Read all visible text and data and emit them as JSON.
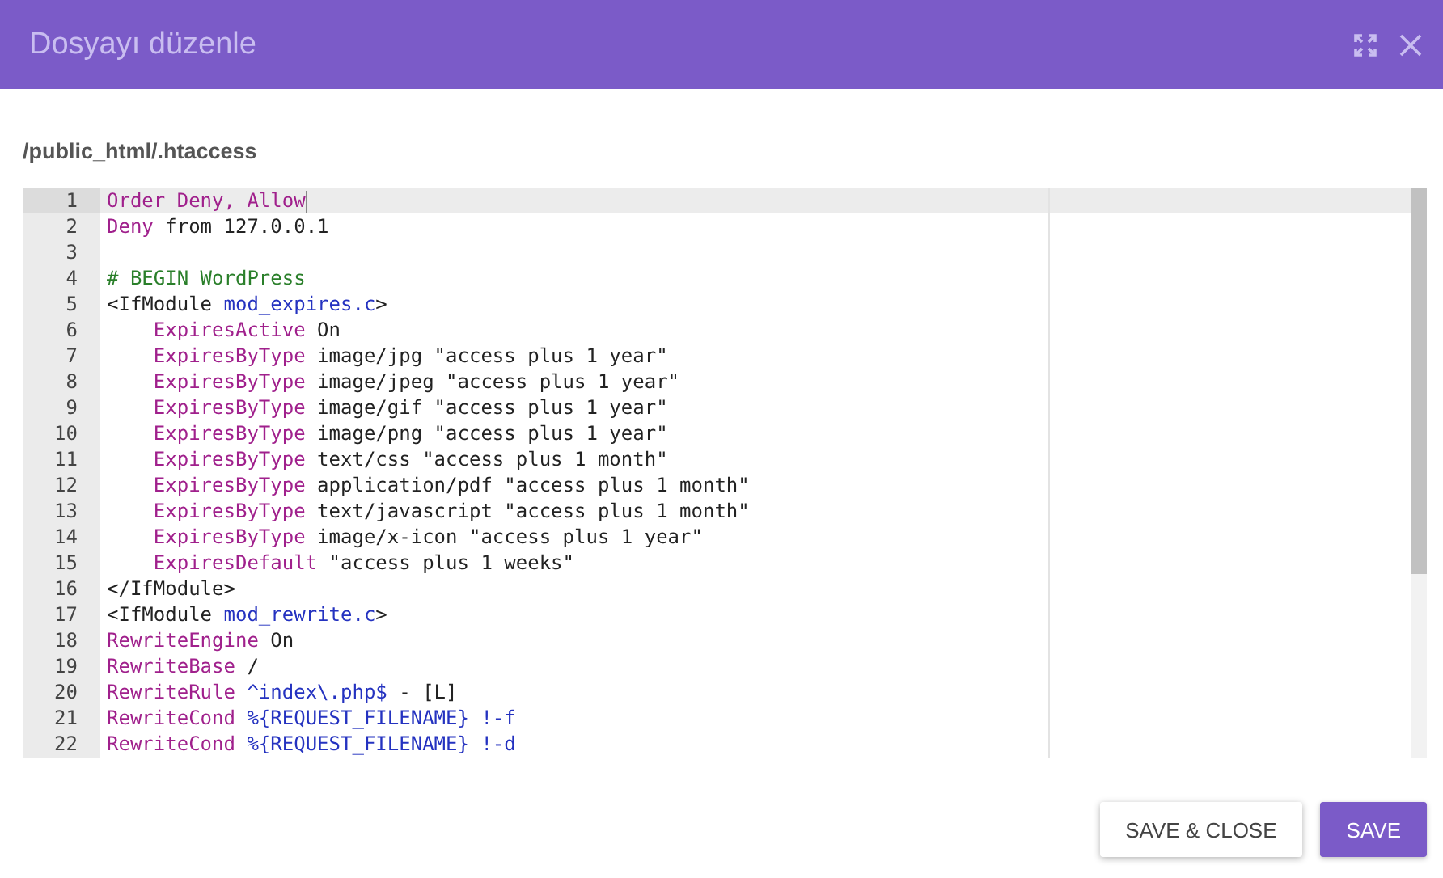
{
  "dialog": {
    "title": "Dosyayı düzenle"
  },
  "file_path": "/public_html/.htaccess",
  "editor": {
    "lines": [
      {
        "number": "1",
        "active": true,
        "tokens": [
          {
            "text": "Order Deny, Allow",
            "kind": "keyword"
          }
        ]
      },
      {
        "number": "2",
        "active": false,
        "tokens": [
          {
            "text": "Deny",
            "kind": "keyword"
          },
          {
            "text": " from 127.0.0.1",
            "kind": "plain"
          }
        ]
      },
      {
        "number": "3",
        "active": false
      },
      {
        "number": "4",
        "active": false,
        "tokens": [
          {
            "text": "# BEGIN WordPress",
            "kind": "comment"
          }
        ]
      },
      {
        "number": "5",
        "active": false,
        "tokens": [
          {
            "text": "<IfModule ",
            "kind": "plain"
          },
          {
            "text": "mod_expires.c",
            "kind": "atom"
          },
          {
            "text": ">",
            "kind": "plain"
          }
        ]
      },
      {
        "number": "6",
        "active": false,
        "tokens": [
          {
            "text": "    ExpiresActive",
            "kind": "keyword"
          },
          {
            "text": " On",
            "kind": "plain"
          }
        ]
      },
      {
        "number": "7",
        "active": false,
        "tokens": [
          {
            "text": "    ExpiresByType",
            "kind": "keyword"
          },
          {
            "text": " image/jpg \"access plus 1 year\"",
            "kind": "plain"
          }
        ]
      },
      {
        "number": "8",
        "active": false,
        "tokens": [
          {
            "text": "    ExpiresByType",
            "kind": "keyword"
          },
          {
            "text": " image/jpeg \"access plus 1 year\"",
            "kind": "plain"
          }
        ]
      },
      {
        "number": "9",
        "active": false,
        "tokens": [
          {
            "text": "    ExpiresByType",
            "kind": "keyword"
          },
          {
            "text": " image/gif \"access plus 1 year\"",
            "kind": "plain"
          }
        ]
      },
      {
        "number": "10",
        "active": false,
        "tokens": [
          {
            "text": "    ExpiresByType",
            "kind": "keyword"
          },
          {
            "text": " image/png \"access plus 1 year\"",
            "kind": "plain"
          }
        ]
      },
      {
        "number": "11",
        "active": false,
        "tokens": [
          {
            "text": "    ExpiresByType",
            "kind": "keyword"
          },
          {
            "text": " text/css \"access plus 1 month\"",
            "kind": "plain"
          }
        ]
      },
      {
        "number": "12",
        "active": false,
        "tokens": [
          {
            "text": "    ExpiresByType",
            "kind": "keyword"
          },
          {
            "text": " application/pdf \"access plus 1 month\"",
            "kind": "plain"
          }
        ]
      },
      {
        "number": "13",
        "active": false,
        "tokens": [
          {
            "text": "    ExpiresByType",
            "kind": "keyword"
          },
          {
            "text": " text/javascript \"access plus 1 month\"",
            "kind": "plain"
          }
        ]
      },
      {
        "number": "14",
        "active": false,
        "tokens": [
          {
            "text": "    ExpiresByType",
            "kind": "keyword"
          },
          {
            "text": " image/x-icon \"access plus 1 year\"",
            "kind": "plain"
          }
        ]
      },
      {
        "number": "15",
        "active": false,
        "tokens": [
          {
            "text": "    ExpiresDefault",
            "kind": "keyword"
          },
          {
            "text": " \"access plus 1 weeks\"",
            "kind": "plain"
          }
        ]
      },
      {
        "number": "16",
        "active": false,
        "tokens": [
          {
            "text": "</IfModule>",
            "kind": "plain"
          }
        ]
      },
      {
        "number": "17",
        "active": false,
        "tokens": [
          {
            "text": "<IfModule ",
            "kind": "plain"
          },
          {
            "text": "mod_rewrite.c",
            "kind": "atom"
          },
          {
            "text": ">",
            "kind": "plain"
          }
        ]
      },
      {
        "number": "18",
        "active": false,
        "tokens": [
          {
            "text": "RewriteEngine",
            "kind": "keyword"
          },
          {
            "text": " On",
            "kind": "plain"
          }
        ]
      },
      {
        "number": "19",
        "active": false,
        "tokens": [
          {
            "text": "RewriteBase",
            "kind": "keyword"
          },
          {
            "text": " /",
            "kind": "plain"
          }
        ]
      },
      {
        "number": "20",
        "active": false,
        "tokens": [
          {
            "text": "RewriteRule",
            "kind": "keyword"
          },
          {
            "text": " ^index\\.php$",
            "kind": "atom"
          },
          {
            "text": " - [L]",
            "kind": "plain"
          }
        ]
      },
      {
        "number": "21",
        "active": false,
        "tokens": [
          {
            "text": "RewriteCond",
            "kind": "keyword"
          },
          {
            "text": " %{REQUEST_FILENAME} !-f",
            "kind": "atom"
          }
        ]
      },
      {
        "number": "22",
        "active": false,
        "tokens": [
          {
            "text": "RewriteCond",
            "kind": "keyword"
          },
          {
            "text": " %{REQUEST_FILENAME} !-d",
            "kind": "atom"
          }
        ]
      }
    ]
  },
  "buttons": [
    {
      "label": "SAVE & CLOSE",
      "kind": "secondary"
    },
    {
      "label": "SAVE",
      "kind": "primary"
    }
  ]
}
